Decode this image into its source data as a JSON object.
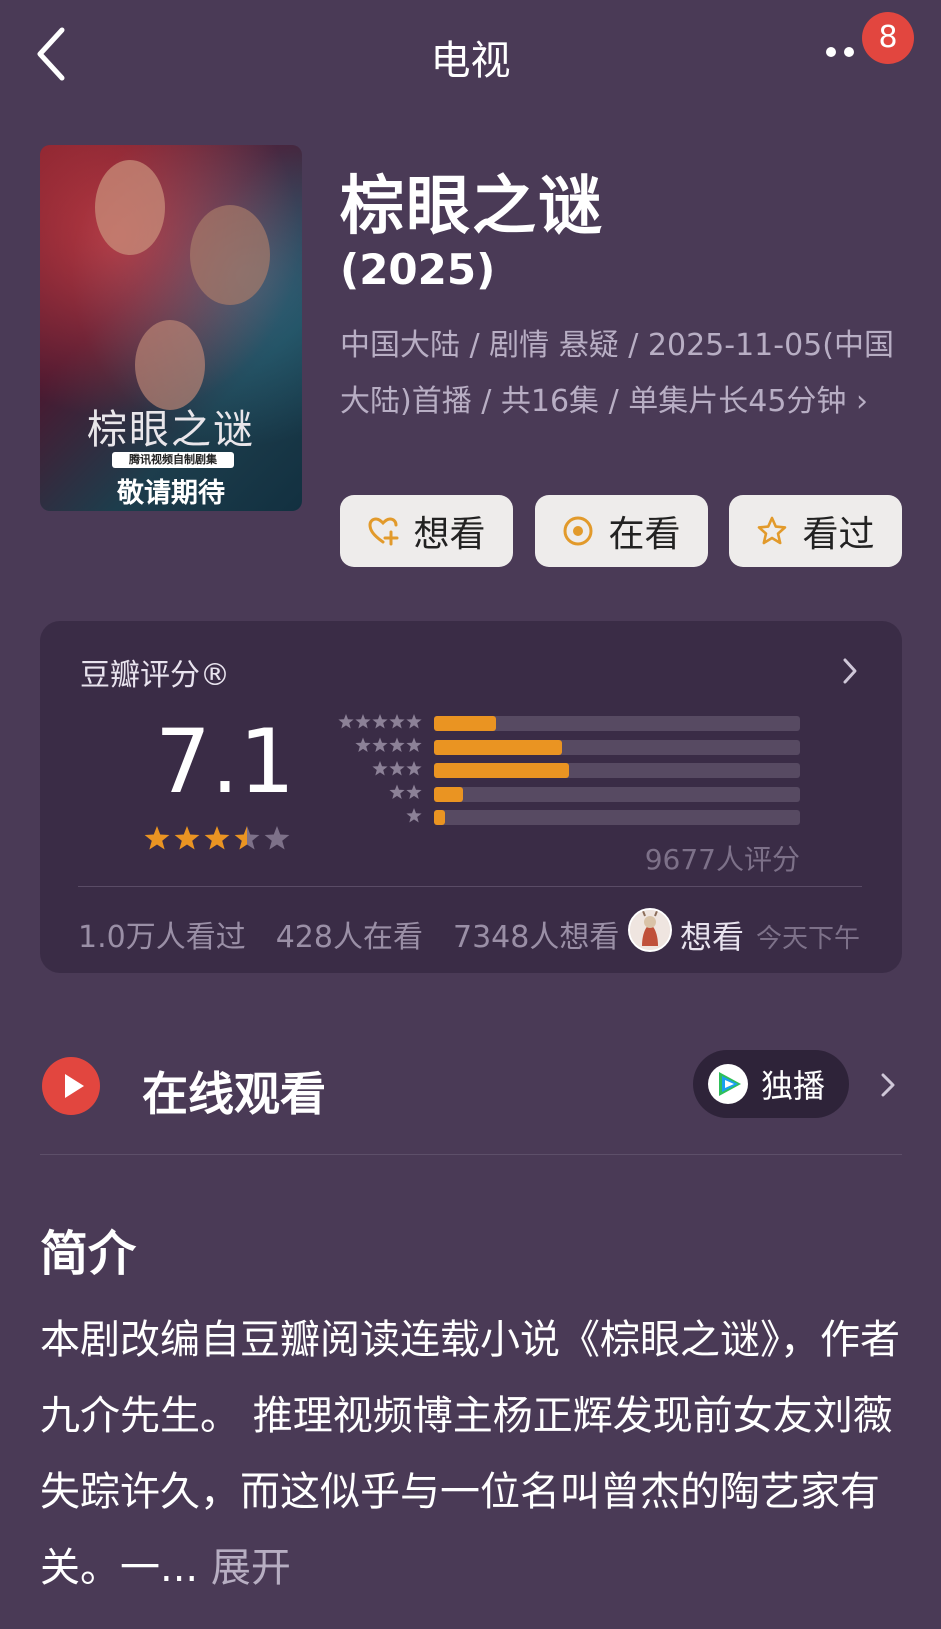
{
  "header": {
    "title": "电视",
    "notification_count": "8",
    "icons": [
      "back-chevron-icon",
      "more-dots-icon"
    ]
  },
  "poster": {
    "title_text": "棕眼之谜",
    "subtitle_text": "腾讯视频自制剧集",
    "footer_text": "敬请期待"
  },
  "show": {
    "title": "棕眼之谜",
    "year": "(2025)",
    "meta": "中国大陆 / 剧情 悬疑 / 2025-11-05(中国大陆)首播 / 共16集 / 单集片长45分钟",
    "meta_chevron": "›"
  },
  "actions": [
    {
      "label": "想看",
      "icon": "heart-plus-icon"
    },
    {
      "label": "在看",
      "icon": "target-icon"
    },
    {
      "label": "看过",
      "icon": "star-outline-icon"
    }
  ],
  "rating": {
    "title": "豆瓣评分®",
    "score": "7.1",
    "stars_filled": 3.5,
    "stars_total": 5,
    "distribution": [
      {
        "stars": 5,
        "fraction": 0.17
      },
      {
        "stars": 4,
        "fraction": 0.35
      },
      {
        "stars": 3,
        "fraction": 0.37
      },
      {
        "stars": 2,
        "fraction": 0.08
      },
      {
        "stars": 1,
        "fraction": 0.03
      }
    ],
    "count_text": "9677人评分",
    "watched": "1.0万人看过",
    "watching": "428人在看",
    "want": "7348人想看",
    "my_status": "想看",
    "my_time": "今天下午"
  },
  "online": {
    "title": "在线观看",
    "pill_label": "独播"
  },
  "intro": {
    "title": "简介",
    "text": "本剧改编自豆瓣阅读连载小说《棕眼之谜》，作者九介先生。 推理视频博主杨正辉发现前女友刘薇失踪许久，而这似乎与一位名叫曾杰的陶艺家有关。一...",
    "expand": "展开"
  },
  "colors": {
    "background": "#4a3a56",
    "card": "#3a2c46",
    "accent": "#ea9422",
    "badge": "#e2463f"
  }
}
